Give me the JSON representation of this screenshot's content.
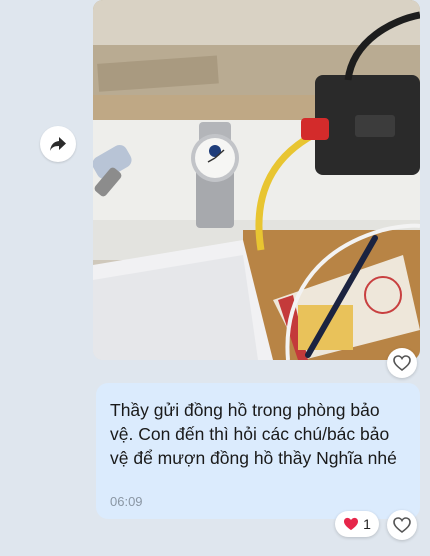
{
  "message": {
    "text": "Thầy gửi đồng hồ trong phòng bảo vệ. Con đến thì hỏi các chú/bác bảo vệ để mượn đồng hồ thầy Nghĩa nhé",
    "time": "06:09"
  },
  "reactions": {
    "message_count": "1",
    "emoji_icon": "heart-filled-icon",
    "react_icon": "heart-outline-icon"
  },
  "photo": {
    "forward_icon": "share-forward-icon"
  },
  "colors": {
    "bubble": "#dbebfd",
    "background": "#dfe6ee",
    "heart": "#e6264a"
  }
}
